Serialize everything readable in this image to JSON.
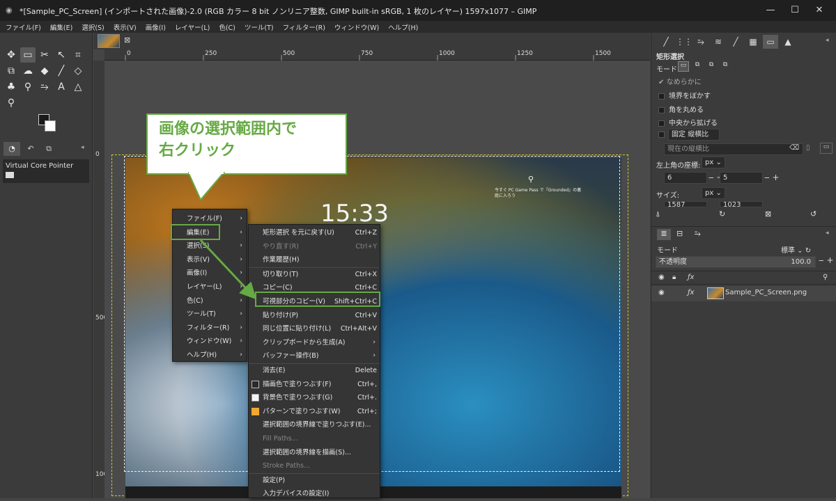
{
  "window": {
    "title": "*[Sample_PC_Screen] (インポートされた画像)-2.0 (RGB カラー 8 bit ノンリニア整数, GIMP built-in sRGB, 1 枚のレイヤー) 1597x1077 – GIMP",
    "minimize": "—",
    "maximize": "☐",
    "close": "✕"
  },
  "menubar": [
    "ファイル(F)",
    "編集(E)",
    "選択(S)",
    "表示(V)",
    "画像(I)",
    "レイヤー(L)",
    "色(C)",
    "ツール(T)",
    "フィルター(R)",
    "ウィンドウ(W)",
    "ヘルプ(H)"
  ],
  "toolbox": {
    "device_status_label": "Virtual Core Pointer"
  },
  "ruler": {
    "top_labels": [
      "0",
      "250",
      "500",
      "750",
      "1000",
      "1250",
      "1500"
    ],
    "left_labels": [
      "0",
      "500",
      "1000"
    ]
  },
  "lockscreen": {
    "time": "15:33",
    "notice": "今すぐ PC Game Pass で『Grounded』の裏庭に入ろう"
  },
  "callout": {
    "line1": "画像の選択範囲内で",
    "line2": "右クリック"
  },
  "context_menu": [
    {
      "label": "ファイル(F)"
    },
    {
      "label": "編集(E)"
    },
    {
      "label": "選択(S)"
    },
    {
      "label": "表示(V)"
    },
    {
      "label": "画像(I)"
    },
    {
      "label": "レイヤー(L)"
    },
    {
      "label": "色(C)"
    },
    {
      "label": "ツール(T)"
    },
    {
      "label": "フィルター(R)"
    },
    {
      "label": "ウィンドウ(W)"
    },
    {
      "label": "ヘルプ(H)"
    }
  ],
  "edit_submenu": [
    {
      "label": "矩形選択 を元に戻す(U)",
      "shortcut": "Ctrl+Z"
    },
    {
      "label": "やり直す(R)",
      "shortcut": "Ctrl+Y",
      "disabled": true
    },
    {
      "label": "作業履歴(H)",
      "shortcut": ""
    },
    {
      "label": "切り取り(T)",
      "shortcut": "Ctrl+X"
    },
    {
      "label": "コピー(C)",
      "shortcut": "Ctrl+C"
    },
    {
      "label": "可視部分のコピー(V)",
      "shortcut": "Shift+Ctrl+C"
    },
    {
      "label": "貼り付け(P)",
      "shortcut": "Ctrl+V"
    },
    {
      "label": "同じ位置に貼り付け(L)",
      "shortcut": "Ctrl+Alt+V"
    },
    {
      "label": "クリップボードから生成(A)",
      "shortcut": ""
    },
    {
      "label": "バッファー操作(B)",
      "shortcut": ""
    },
    {
      "label": "消去(E)",
      "shortcut": "Delete"
    },
    {
      "label": "描画色で塗りつぶす(F)",
      "shortcut": "Ctrl+,"
    },
    {
      "label": "背景色で塗りつぶす(G)",
      "shortcut": "Ctrl+."
    },
    {
      "label": "パターンで塗りつぶす(W)",
      "shortcut": "Ctrl+;"
    },
    {
      "label": "選択範囲の境界線で塗りつぶす(E)...",
      "shortcut": ""
    },
    {
      "label": "Fill Paths...",
      "shortcut": "",
      "disabled": true
    },
    {
      "label": "選択範囲の境界線を描画(S)...",
      "shortcut": ""
    },
    {
      "label": "Stroke Paths...",
      "shortcut": "",
      "disabled": true
    },
    {
      "label": "設定(P)",
      "shortcut": ""
    },
    {
      "label": "入力デバイスの設定(I)",
      "shortcut": ""
    }
  ],
  "tool_options": {
    "title": "矩形選択",
    "mode_label": "モード:",
    "antialias": "なめらかに",
    "feather": "境界をぼかす",
    "rounded": "角を丸める",
    "expand_center": "中央から拡げる",
    "fixed": "固定",
    "fixed_value": "縦横比",
    "current_ratio": "現在の縦横比",
    "position_label": "左上角の座標:",
    "position_unit": "px",
    "pos_x": "6",
    "pos_y": "5",
    "size_label": "サイズ:",
    "size_unit": "px",
    "size_w": "1587",
    "size_h": "1023"
  },
  "layers": {
    "mode_label": "モード",
    "mode_value": "標準",
    "opacity_label": "不透明度",
    "opacity_value": "100.0",
    "layer_name": "Sample_PC_Screen.png"
  }
}
